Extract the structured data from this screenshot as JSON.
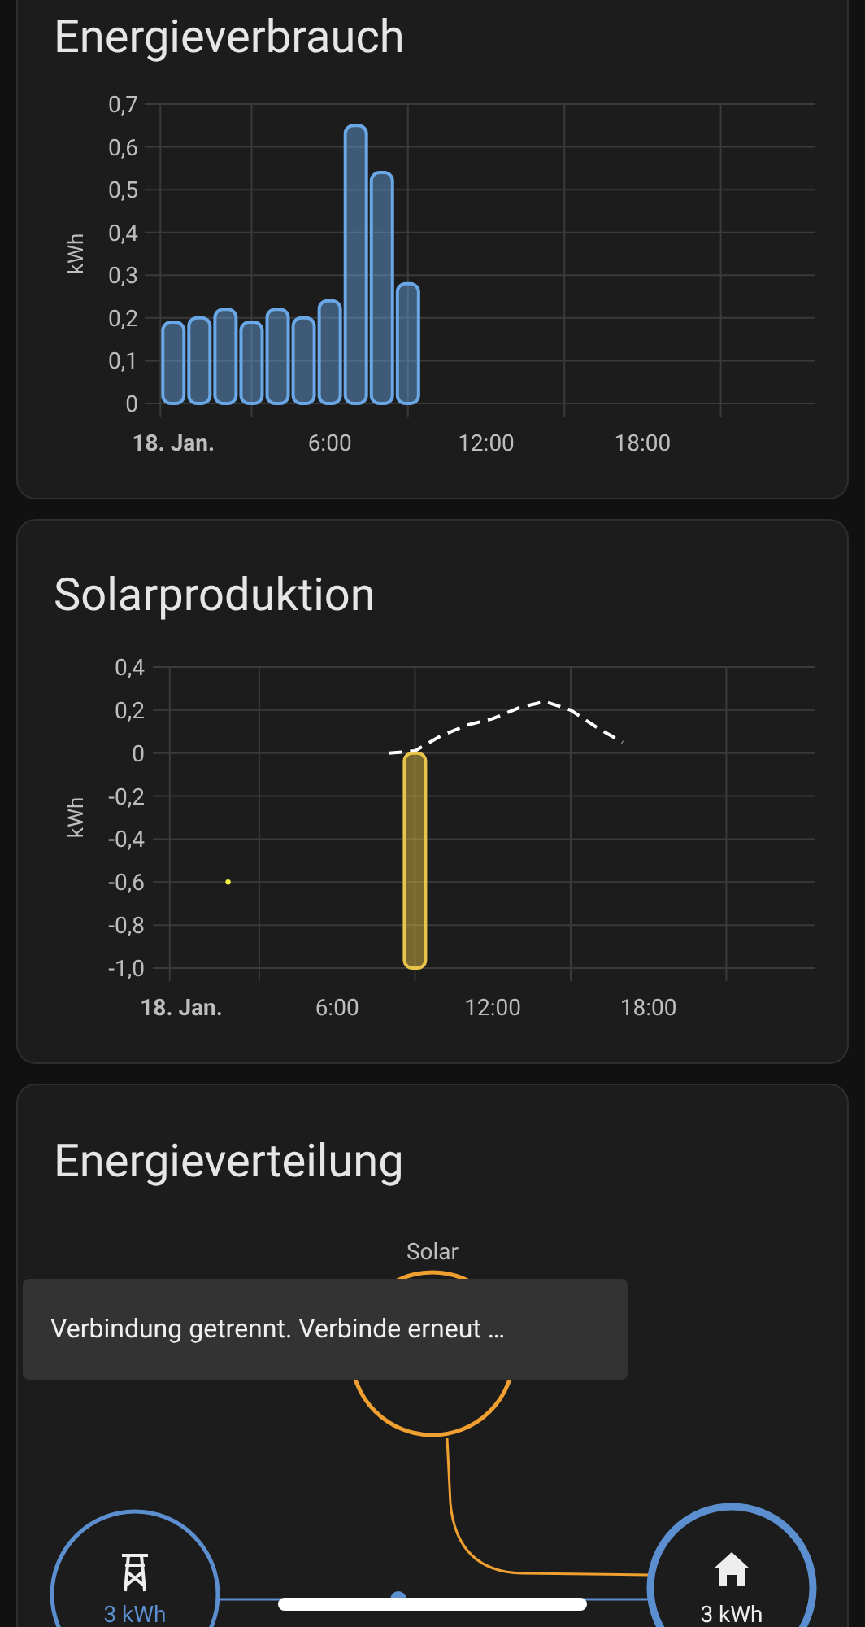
{
  "cards": [
    {
      "kind": "consumption",
      "title": "Energieverbrauch",
      "chart_data": {
        "type": "bar",
        "ylabel": "kWh",
        "x": [
          0,
          1,
          2,
          3,
          4,
          5,
          6,
          7,
          8,
          9
        ],
        "series": [
          {
            "color": "#6aa7e6",
            "values": [
              0.19,
              0.2,
              0.22,
              0.19,
              0.22,
              0.2,
              0.24,
              0.65,
              0.54,
              0.28
            ]
          }
        ],
        "xlim": [
          -1.1,
          24.6
        ],
        "ylim": [
          0,
          0.7
        ],
        "grid": true,
        "xticks": [
          {
            "value": 0,
            "label": "18. Jan."
          },
          {
            "value": 6,
            "label": "6:00"
          },
          {
            "value": 12,
            "label": "12:00"
          },
          {
            "value": 18,
            "label": "18:00"
          }
        ],
        "yticks": [
          {
            "value": 0,
            "label": "0"
          },
          {
            "value": 0.1,
            "label": "0,1"
          },
          {
            "value": 0.2,
            "label": "0,2"
          },
          {
            "value": 0.3,
            "label": "0,3"
          },
          {
            "value": 0.4,
            "label": "0,4"
          },
          {
            "value": 0.5,
            "label": "0,5"
          },
          {
            "value": 0.6,
            "label": "0,6"
          },
          {
            "value": 0.7,
            "label": "0,7"
          }
        ]
      }
    },
    {
      "kind": "solar",
      "title": "Solarproduktion",
      "chart_data": {
        "type": "bar",
        "ylabel": "kWh",
        "x": [
          1.8,
          8,
          9,
          10,
          11,
          12,
          13,
          14,
          15,
          16,
          17
        ],
        "series": [
          {
            "type": "bar",
            "color": "#e8c54a",
            "values": [
              null,
              null,
              -1.0,
              null,
              null,
              null,
              null,
              null,
              null,
              null,
              null
            ]
          },
          {
            "type": "scatter",
            "color": "#f5f542",
            "values": [
              -0.6,
              null,
              null,
              null,
              null,
              null,
              null,
              null,
              null,
              null,
              null
            ]
          },
          {
            "type": "line",
            "line_style": "dashed",
            "color": "#ffffff",
            "values": [
              null,
              0,
              0.01,
              0.08,
              0.13,
              0.16,
              0.21,
              0.24,
              0.2,
              0.12,
              0.05
            ]
          }
        ],
        "xlim": [
          -1.1,
          24.4
        ],
        "ylim": [
          -1.0,
          0.4
        ],
        "grid": true,
        "xticks": [
          {
            "value": 0,
            "label": "18. Jan."
          },
          {
            "value": 6,
            "label": "6:00"
          },
          {
            "value": 12,
            "label": "12:00"
          },
          {
            "value": 18,
            "label": "18:00"
          }
        ],
        "yticks": [
          {
            "value": -1.0,
            "label": "-1,0"
          },
          {
            "value": -0.8,
            "label": "-0,8"
          },
          {
            "value": -0.6,
            "label": "-0,6"
          },
          {
            "value": -0.4,
            "label": "-0,4"
          },
          {
            "value": -0.2,
            "label": "-0,2"
          },
          {
            "value": 0,
            "label": "0"
          },
          {
            "value": 0.2,
            "label": "0,2"
          },
          {
            "value": 0.4,
            "label": "0,4"
          }
        ]
      }
    },
    {
      "kind": "distribution",
      "title": "Energieverteilung",
      "solar": {
        "label": "Solar"
      },
      "grid": {
        "value": "3 kWh"
      },
      "home": {
        "value": "3 kWh"
      }
    }
  ],
  "toast": {
    "message": "Verbindung getrennt. Verbinde erneut …"
  }
}
